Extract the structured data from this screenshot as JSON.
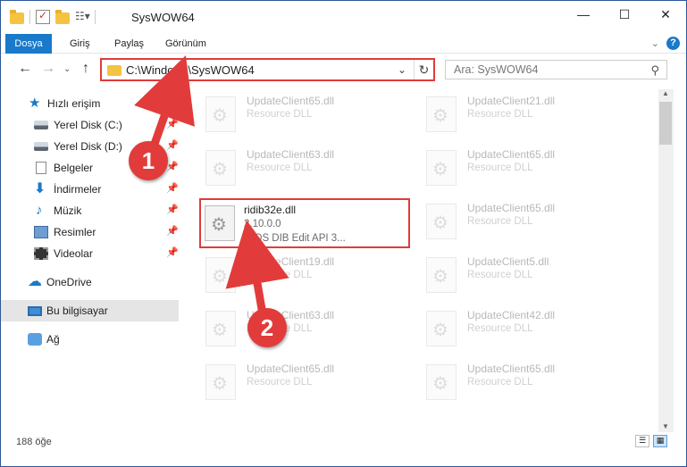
{
  "window": {
    "title": "SysWOW64",
    "minimize_icon": "minimize-icon",
    "maximize_icon": "maximize-icon",
    "close_icon": "close-icon"
  },
  "ribbon": {
    "tabs": [
      {
        "label": "Dosya",
        "active": true
      },
      {
        "label": "Giriş"
      },
      {
        "label": "Paylaş"
      },
      {
        "label": "Görünüm"
      }
    ]
  },
  "address": {
    "path": "C:\\Windows\\SysWOW64"
  },
  "search": {
    "placeholder": "Ara: SysWOW64"
  },
  "sidebar": {
    "items": [
      {
        "label": "Hızlı erişim",
        "icon": "star-icon"
      },
      {
        "label": "Yerel Disk (C:)",
        "icon": "drive-icon",
        "pinned": true
      },
      {
        "label": "Yerel Disk (D:)",
        "icon": "drive-icon",
        "pinned": true
      },
      {
        "label": "Belgeler",
        "icon": "document-icon",
        "pinned": true
      },
      {
        "label": "İndirmeler",
        "icon": "download-icon",
        "pinned": true
      },
      {
        "label": "Müzik",
        "icon": "music-icon",
        "pinned": true
      },
      {
        "label": "Resimler",
        "icon": "pictures-icon",
        "pinned": true
      },
      {
        "label": "Videolar",
        "icon": "video-icon",
        "pinned": true
      },
      {
        "label": "OneDrive",
        "icon": "cloud-icon"
      },
      {
        "label": "Bu bilgisayar",
        "icon": "computer-icon",
        "selected": true
      },
      {
        "label": "Ağ",
        "icon": "network-icon"
      }
    ]
  },
  "files": [
    {
      "name": "UpdateClient65.dll",
      "line2": "Resource DLL",
      "line3": ""
    },
    {
      "name": "UpdateClient21.dll",
      "line2": "Resource DLL",
      "line3": ""
    },
    {
      "name": "UpdateClient63.dll",
      "line2": "Resource DLL",
      "line3": ""
    },
    {
      "name": "UpdateClient65.dll",
      "line2": "Resource DLL",
      "line3": ""
    },
    {
      "name": "ridib32e.dll",
      "line2": "2.10.0.0",
      "line3": "RIOS DIB Edit API 3..."
    },
    {
      "name": "UpdateClient65.dll",
      "line2": "Resource DLL",
      "line3": ""
    },
    {
      "name": "UpdateClient19.dll",
      "line2": "Resource DLL",
      "line3": ""
    },
    {
      "name": "UpdateClient5.dll",
      "line2": "Resource DLL",
      "line3": ""
    },
    {
      "name": "UpdateClient63.dll",
      "line2": "Resource DLL",
      "line3": ""
    },
    {
      "name": "UpdateClient42.dll",
      "line2": "Resource DLL",
      "line3": ""
    },
    {
      "name": "UpdateClient65.dll",
      "line2": "Resource DLL",
      "line3": ""
    },
    {
      "name": "UpdateClient65.dll",
      "line2": "Resource DLL",
      "line3": ""
    }
  ],
  "status": {
    "count": "188 öğe"
  },
  "annotations": {
    "step1": "1",
    "step2": "2",
    "highlight_color": "#e03b3b"
  }
}
